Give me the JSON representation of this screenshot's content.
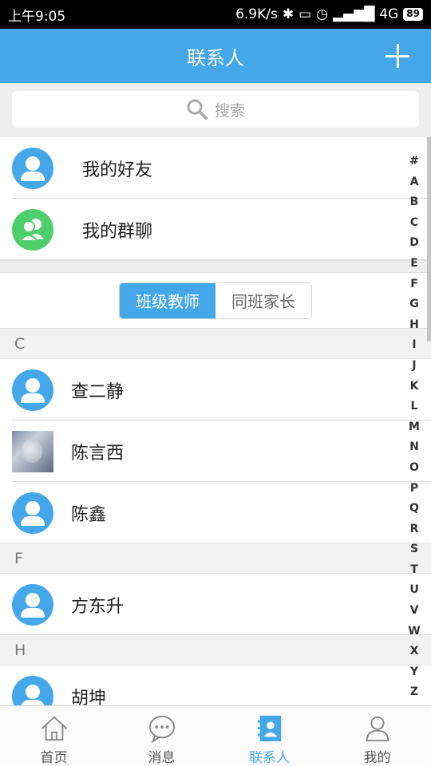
{
  "status": {
    "time": "上午9:05",
    "speed": "6.9K/s",
    "network": "4G",
    "battery": "89"
  },
  "header": {
    "title": "联系人"
  },
  "search": {
    "placeholder": "搜索"
  },
  "top": [
    {
      "label": "我的好友"
    },
    {
      "label": "我的群聊"
    }
  ],
  "segments": [
    {
      "label": "班级教师"
    },
    {
      "label": "同班家长"
    }
  ],
  "groups": [
    {
      "letter": "C",
      "contacts": [
        "查二静",
        "陈言西",
        "陈鑫"
      ]
    },
    {
      "letter": "F",
      "contacts": [
        "方东升"
      ]
    },
    {
      "letter": "H",
      "contacts": [
        "胡坤"
      ]
    }
  ],
  "index": [
    "#",
    "A",
    "B",
    "C",
    "D",
    "E",
    "F",
    "G",
    "H",
    "I",
    "J",
    "K",
    "L",
    "M",
    "N",
    "O",
    "P",
    "Q",
    "R",
    "S",
    "T",
    "U",
    "V",
    "W",
    "X",
    "Y",
    "Z"
  ],
  "tabs": [
    {
      "label": "首页"
    },
    {
      "label": "消息"
    },
    {
      "label": "联系人"
    },
    {
      "label": "我的"
    }
  ],
  "colors": {
    "accent": "#44a7ea",
    "group_avatar": "#4fcf6b"
  }
}
